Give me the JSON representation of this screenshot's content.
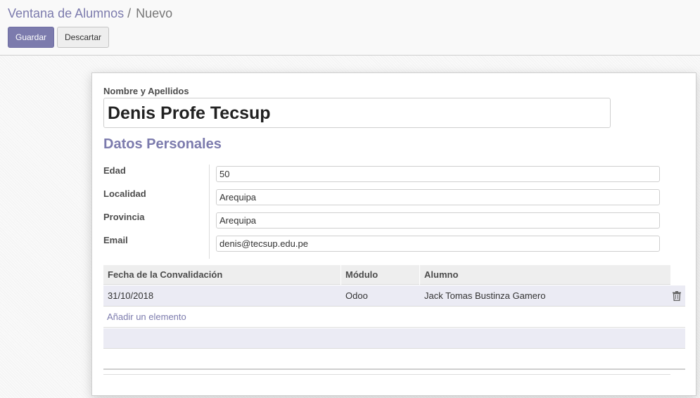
{
  "breadcrumb": {
    "parent": "Ventana de Alumnos",
    "separator": "/",
    "current": "Nuevo"
  },
  "buttons": {
    "save": "Guardar",
    "discard": "Descartar"
  },
  "form": {
    "name_label": "Nombre y Apellidos",
    "name_value": "Denis Profe Tecsup",
    "group_title": "Datos Personales",
    "fields": [
      {
        "label": "Edad",
        "value": "50"
      },
      {
        "label": "Localidad",
        "value": "Arequipa"
      },
      {
        "label": "Provincia",
        "value": "Arequipa"
      },
      {
        "label": "Email",
        "value": "denis@tecsup.edu.pe"
      }
    ]
  },
  "table": {
    "columns": [
      "Fecha de la Convalidación",
      "Módulo",
      "Alumno"
    ],
    "rows": [
      [
        "31/10/2018",
        "Odoo",
        "Jack Tomas Bustinza Gamero"
      ]
    ],
    "add_label": "Añadir un elemento",
    "row_action_icon": "trash-icon"
  },
  "colors": {
    "accent": "#7c7bad",
    "row_highlight": "#ebebf4"
  }
}
